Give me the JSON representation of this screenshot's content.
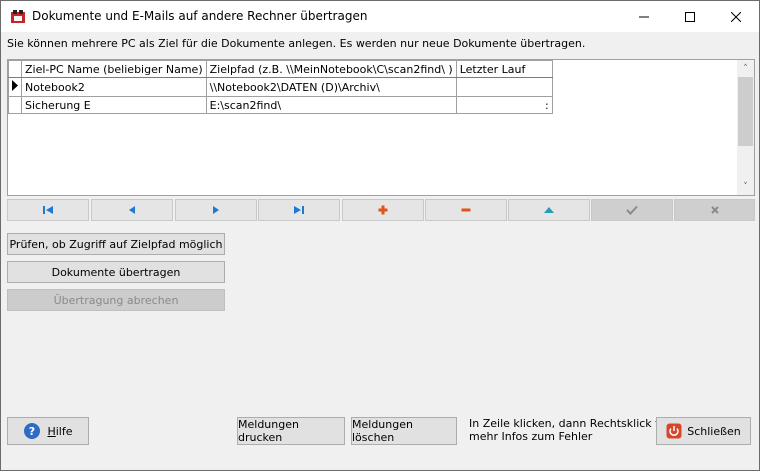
{
  "window": {
    "title": "Dokumente und E-Mails auf andere Rechner übertragen"
  },
  "hint": "Sie können mehrere PC als Ziel für die Dokumente anlegen. Es werden nur neue Dokumente übertragen.",
  "grid": {
    "columns": [
      "Ziel-PC Name (beliebiger Name)",
      "Zielpfad (z.B. \\\\MeinNotebook\\C\\scan2find\\ )",
      "Letzter Lauf"
    ],
    "rows": [
      {
        "name": "Notebook2",
        "path": "\\\\Notebook2\\DATEN (D)\\Archiv\\",
        "last": ""
      },
      {
        "name": "Sicherung E",
        "path": "E:\\scan2find\\",
        "last": ":"
      }
    ]
  },
  "navigator": [
    "first",
    "prior",
    "next",
    "last",
    "insert",
    "delete",
    "edit",
    "post",
    "cancel"
  ],
  "buttons": {
    "check_access": "Prüfen, ob Zugriff auf Zielpfad möglich",
    "transfer": "Dokumente übertragen",
    "abort": "Übertragung abrechen",
    "help_prefix": "H",
    "help_rest": "ilfe",
    "print_messages": "Meldungen drucken",
    "delete_messages": "Meldungen löschen",
    "close": "Schließen"
  },
  "footer_note_line1": "In Zeile klicken, dann Rechtsklick  für",
  "footer_note_line2": "mehr Infos zum Fehler",
  "colors": {
    "nav_blue": "#1e78d6",
    "nav_orange": "#e0541a",
    "nav_teal": "#2a9bb5",
    "close_red": "#d9452b",
    "help_blue": "#2f6bc6"
  }
}
